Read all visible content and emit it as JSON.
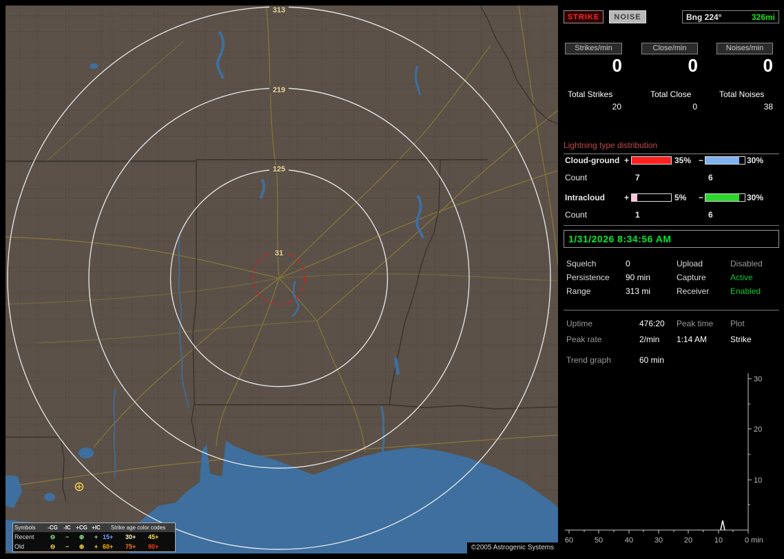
{
  "toolbar": {
    "strike_label": "STRIKE",
    "noise_label": "NOISE",
    "bearing_label": "Bng 224°",
    "bearing_range": "326mi"
  },
  "rates": {
    "strikes": {
      "header": "Strikes/min",
      "value": "0",
      "total_label": "Total Strikes",
      "total_value": "20"
    },
    "close": {
      "header": "Close/min",
      "value": "0",
      "total_label": "Total Close",
      "total_value": "0"
    },
    "noises": {
      "header": "Noises/min",
      "value": "0",
      "total_label": "Total Noises",
      "total_value": "38"
    }
  },
  "distribution": {
    "title": "Lightning type distribution",
    "cloud_ground": {
      "label": "Cloud-ground",
      "plus_sign": "+",
      "plus_pct": "35%",
      "plus_fill": "100%",
      "plus_color": "#ff1f1f",
      "minus_sign": "−",
      "minus_pct": "30%",
      "minus_fill": "86%",
      "minus_color": "#7fb2f0",
      "count_label": "Count",
      "plus_count": "7",
      "minus_count": "6"
    },
    "intracloud": {
      "label": "Intracloud",
      "plus_sign": "+",
      "plus_pct": "5%",
      "plus_fill": "14%",
      "plus_color": "#ffc4e0",
      "minus_sign": "−",
      "minus_pct": "30%",
      "minus_fill": "86%",
      "minus_color": "#2ed52e",
      "count_label": "Count",
      "plus_count": "1",
      "minus_count": "6"
    }
  },
  "clock": {
    "datetime": "1/31/2026 8:34:56 AM"
  },
  "settings": {
    "row1": {
      "l1": "Squelch",
      "v1": "0",
      "l2": "Upload",
      "v2": "Disabled",
      "v2_color": "#9c9c9c"
    },
    "row2": {
      "l1": "Persistence",
      "v1": "90 min",
      "l2": "Capture",
      "v2": "Active",
      "v2_color": "#00cc33"
    },
    "row3": {
      "l1": "Range",
      "v1": "313 mi",
      "l2": "Receiver",
      "v2": "Enabled",
      "v2_color": "#00cc33"
    }
  },
  "status": {
    "uptime_label": "Uptime",
    "uptime_value": "476:20",
    "peak_time_label": "Peak time",
    "plot_label": "Plot",
    "peak_rate_label": "Peak rate",
    "peak_rate_value": "2/min",
    "peak_time_value": "1:14 AM",
    "plot_value": "Strike",
    "trend_label": "Trend graph",
    "trend_value": "60 min"
  },
  "chart_data": {
    "type": "line",
    "title": "Strike rate trend, last 60 minutes",
    "x_tick_labels": [
      "60",
      "50",
      "40",
      "30",
      "20",
      "10",
      "0 min"
    ],
    "y_tick_labels": [
      "30",
      "20",
      "10"
    ],
    "xlabel": "min",
    "ylim": [
      0,
      30
    ],
    "x_minutes_ago_range": [
      60,
      0
    ],
    "series": [
      {
        "name": "Strike",
        "baseline_value": 0,
        "points": [
          {
            "min_ago": 9,
            "value": 2
          }
        ]
      }
    ]
  },
  "map": {
    "ring_labels": {
      "r313": "313",
      "r219": "219",
      "r125": "125",
      "r31": "31"
    },
    "copyright": "©2005 Astrogenic Systems",
    "legend": {
      "symbols_header": "Symbols",
      "col_ncg": "-CG",
      "col_nic": "-IC",
      "col_pcg": "+CG",
      "col_pic": "+IC",
      "age_header": "Strike age color codes",
      "recent_label": "Recent",
      "old_label": "Old",
      "sym_ncg": "⊖",
      "sym_nic": "−",
      "sym_pcg": "⊕",
      "sym_pic": "+",
      "recent_color": "#8ee88e",
      "old_color": "#ffd84d",
      "recent_ages": [
        {
          "text": "15+",
          "color": "#6f9bff"
        },
        {
          "text": "30+",
          "color": "#fdf6b8"
        },
        {
          "text": "45+",
          "color": "#ffe04d"
        }
      ],
      "old_ages": [
        {
          "text": "60+",
          "color": "#ffb300"
        },
        {
          "text": "75+",
          "color": "#ff7d1a"
        },
        {
          "text": "90+",
          "color": "#ff3617"
        }
      ]
    }
  }
}
